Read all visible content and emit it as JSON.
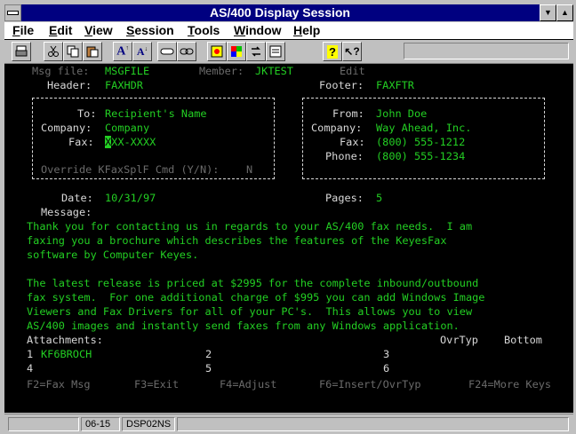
{
  "window": {
    "title": "AS/400 Display Session"
  },
  "menu": [
    "File",
    "Edit",
    "View",
    "Session",
    "Tools",
    "Window",
    "Help"
  ],
  "toolbar": {
    "icons": [
      "print-icon",
      "cut-icon",
      "copy-icon",
      "paste-icon",
      "font-larger-icon",
      "font-smaller-icon",
      "hotspot-icon",
      "link-icon",
      "sound-icon",
      "palette-icon",
      "transfer-icon",
      "macro-icon",
      "help-icon",
      "context-help-icon"
    ]
  },
  "screen": {
    "msg_file_label": "Msg file:",
    "msg_file_value": "MSGFILE",
    "member_label": "Member:",
    "member_value": "JKTEST",
    "edit_label": "Edit",
    "header_label": "Header:",
    "header_value": "FAXHDR",
    "footer_label": "Footer:",
    "footer_value": "FAXFTR",
    "to_label": "To:",
    "to_value": "Recipient's Name",
    "company_label": "Company:",
    "company_value": "Company",
    "fax_label": "Fax:",
    "fax_cursor": "X",
    "fax_value": "XX-XXXX",
    "override_label": "Override KFaxSplF Cmd (Y/N):",
    "override_value": "N",
    "from_label": "From:",
    "from_value": "John Doe",
    "from_company_label": "Company:",
    "from_company_value": "Way Ahead, Inc.",
    "from_fax_label": "Fax:",
    "from_fax_value": "(800) 555-1212",
    "phone_label": "Phone:",
    "phone_value": "(800) 555-1234",
    "date_label": "Date:",
    "date_value": "10/31/97",
    "pages_label": "Pages:",
    "pages_value": "5",
    "message_label": "Message:",
    "message_lines": [
      "Thank you for contacting us in regards to your AS/400 fax needs.  I am",
      "faxing you a brochure which describes the features of the KeyesFax",
      "software by Computer Keyes.",
      "",
      "The latest release is priced at $2995 for the complete inbound/outbound",
      "fax system.  For one additional charge of $995 you can add Windows Image",
      "Viewers and Fax Drivers for all of your PC's.  This allows you to view",
      "AS/400 images and instantly send faxes from any Windows application."
    ],
    "attachments_label": "Attachments:",
    "ovrtyp_label": "OvrTyp",
    "bottom_label": "Bottom",
    "attachments": [
      {
        "num": "1",
        "value": "KF6BROCH"
      },
      {
        "num": "2",
        "value": ""
      },
      {
        "num": "3",
        "value": ""
      },
      {
        "num": "4",
        "value": ""
      },
      {
        "num": "5",
        "value": ""
      },
      {
        "num": "6",
        "value": ""
      }
    ],
    "function_keys": [
      "F2=Fax Msg",
      "F3=Exit",
      "F4=Adjust",
      "F6=Insert/OvrTyp",
      "F24=More Keys"
    ]
  },
  "status": {
    "cursor_pos": "06-15",
    "device": "DSP02NS"
  },
  "colors": {
    "screen_bg": "#000000",
    "field_green": "#23cf23",
    "label_white": "#d8d8d8",
    "dim_gray": "#6b6b6b",
    "titlebar": "#000080"
  }
}
